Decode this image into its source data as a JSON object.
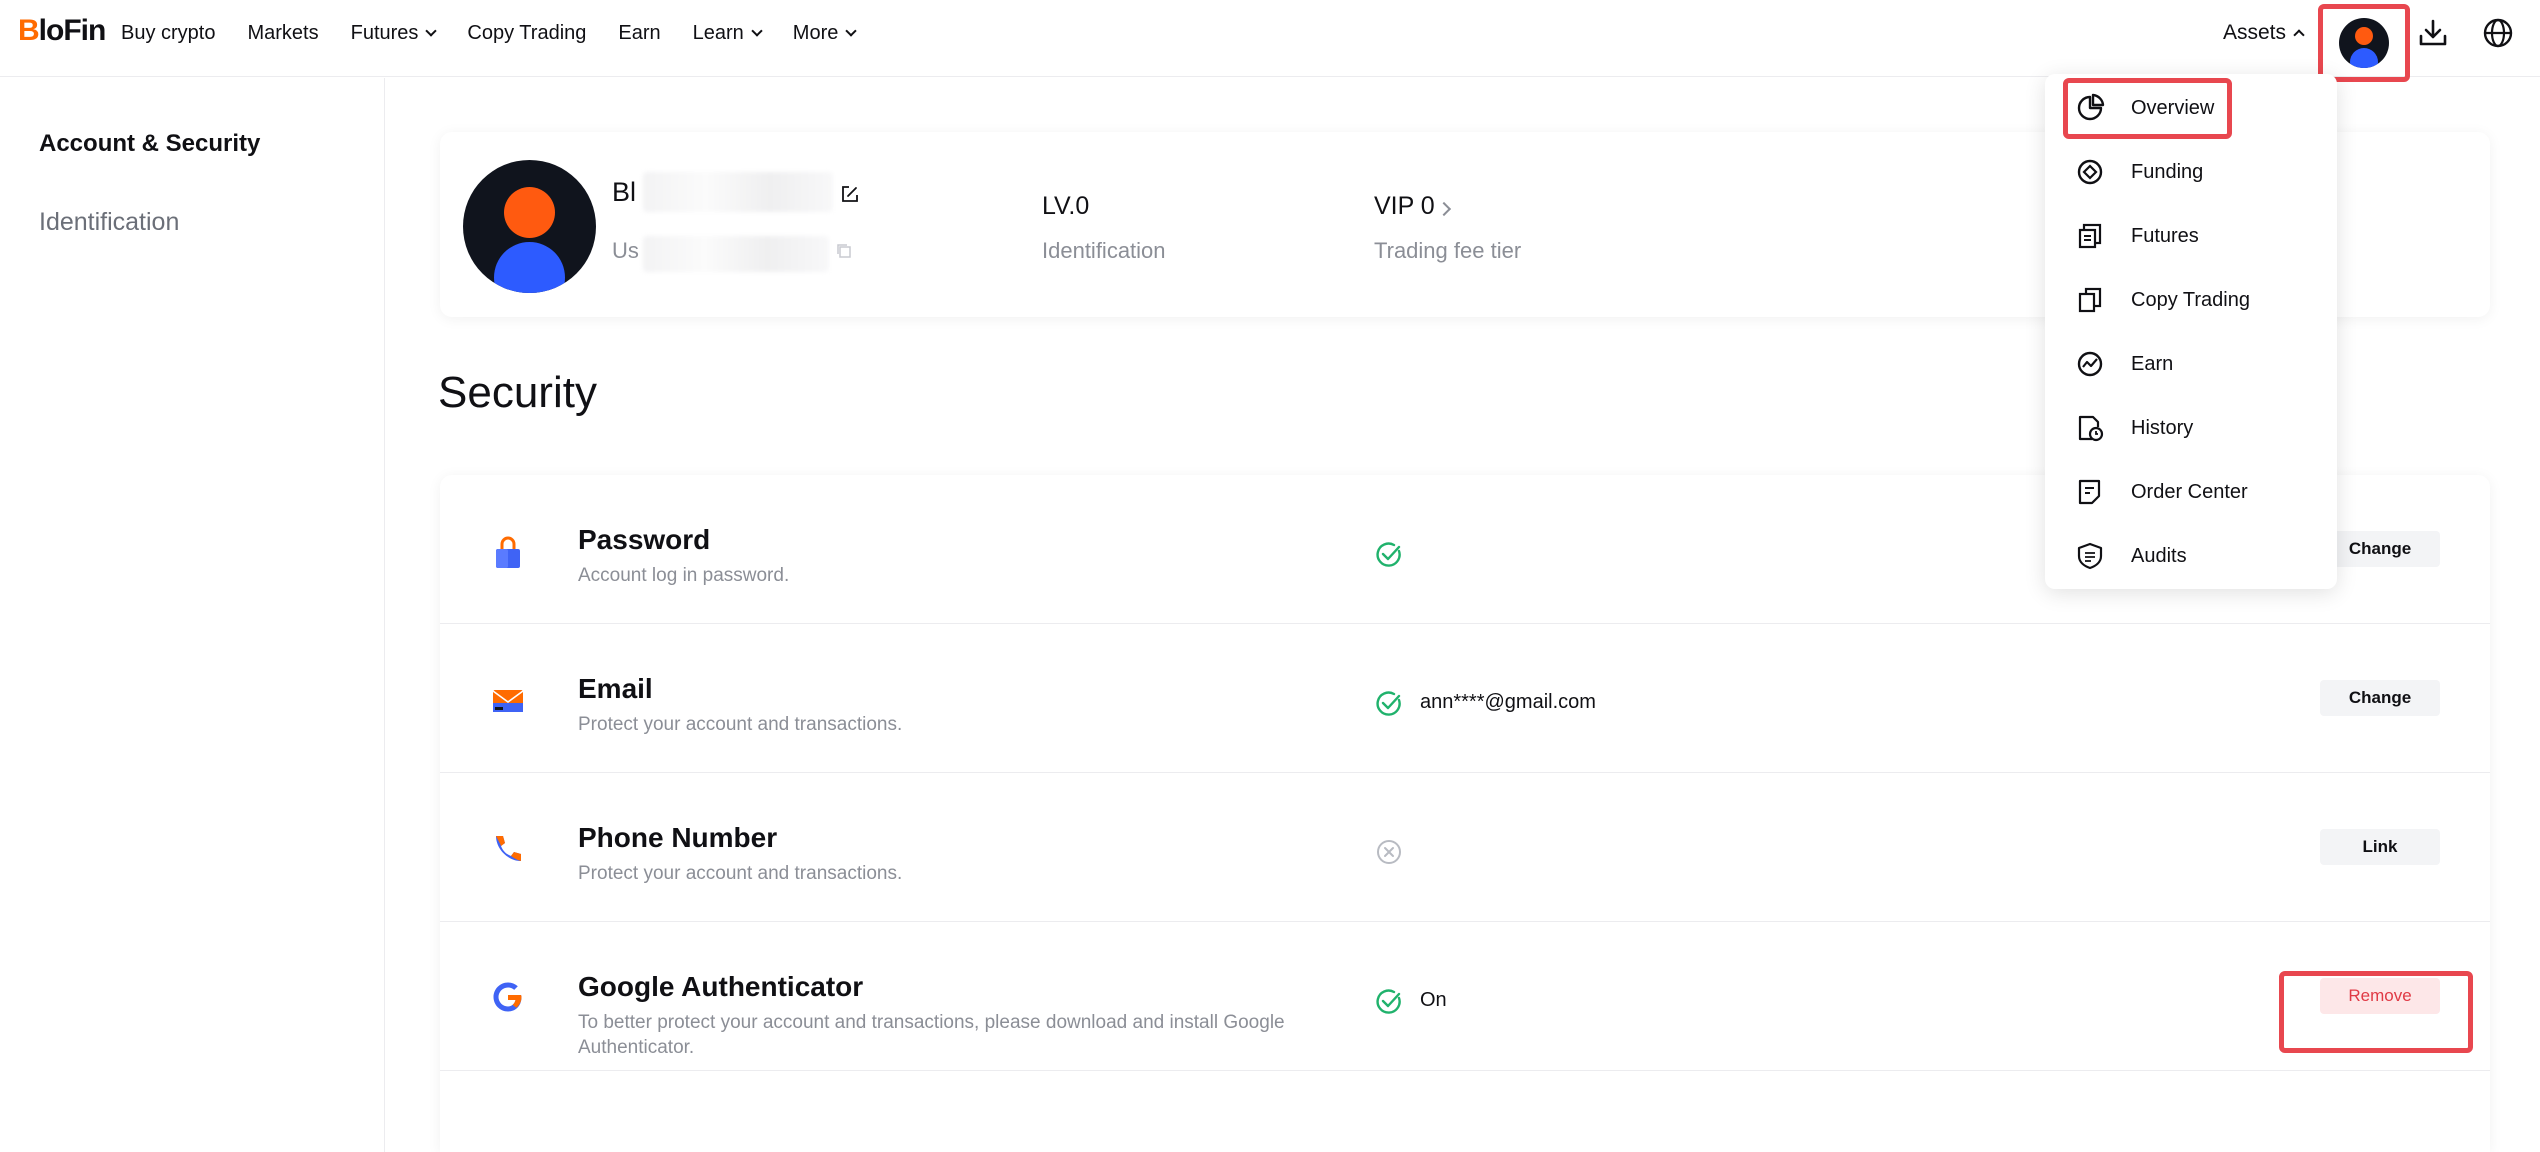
{
  "logo": {
    "text_b": "B",
    "text_rest": "loFin"
  },
  "nav": {
    "items": [
      {
        "label": "Buy crypto",
        "dropdown": false
      },
      {
        "label": "Markets",
        "dropdown": false
      },
      {
        "label": "Futures",
        "dropdown": true
      },
      {
        "label": "Copy Trading",
        "dropdown": false
      },
      {
        "label": "Earn",
        "dropdown": false
      },
      {
        "label": "Learn",
        "dropdown": true
      },
      {
        "label": "More",
        "dropdown": true
      }
    ],
    "assets_label": "Assets"
  },
  "sidebar": {
    "items": [
      {
        "label": "Account & Security",
        "active": true
      },
      {
        "label": "Identification",
        "active": false
      }
    ]
  },
  "profile": {
    "name_prefix": "Bl",
    "uid_prefix": "Us",
    "level": "LV.0",
    "level_sub": "Identification",
    "vip": "VIP 0",
    "vip_sub": "Trading fee tier"
  },
  "security": {
    "title": "Security",
    "rows": [
      {
        "title": "Password",
        "desc": "Account log in password.",
        "status": "ok",
        "status_text": "",
        "action": "Change",
        "icon": "lock-icon"
      },
      {
        "title": "Email",
        "desc": "Protect your account and transactions.",
        "status": "ok",
        "status_text": "ann****@gmail.com",
        "action": "Change",
        "icon": "envelope-icon"
      },
      {
        "title": "Phone Number",
        "desc": "Protect your account and transactions.",
        "status": "off",
        "status_text": "",
        "action": "Link",
        "icon": "phone-icon"
      },
      {
        "title": "Google Authenticator",
        "desc": "To better protect your account and transactions, please download and install Google Authenticator.",
        "status": "ok",
        "status_text": "On",
        "action": "Remove",
        "icon": "google-icon"
      }
    ]
  },
  "assets_menu": {
    "items": [
      {
        "label": "Overview",
        "icon": "pie-chart-icon"
      },
      {
        "label": "Funding",
        "icon": "funding-icon"
      },
      {
        "label": "Futures",
        "icon": "futures-icon"
      },
      {
        "label": "Copy Trading",
        "icon": "copy-icon"
      },
      {
        "label": "Earn",
        "icon": "earn-icon"
      },
      {
        "label": "History",
        "icon": "history-icon"
      },
      {
        "label": "Order Center",
        "icon": "order-center-icon"
      },
      {
        "label": "Audits",
        "icon": "audits-icon"
      }
    ]
  },
  "colors": {
    "brand_orange": "#ff6b00",
    "highlight_red": "#e8474f",
    "success_green": "#20b26c",
    "avatar_blue": "#2d5bff"
  }
}
